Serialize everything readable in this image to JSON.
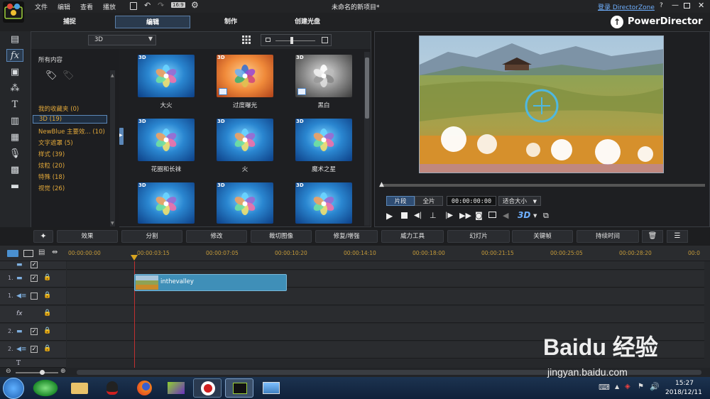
{
  "menu": {
    "file": "文件",
    "edit": "编辑",
    "view": "查看",
    "play": "播放",
    "zoom": "16:9"
  },
  "window_title": "未命名的新项目*",
  "login": "登录 DirectorZone",
  "help": "?",
  "modes": [
    {
      "label": "捕捉"
    },
    {
      "label": "编辑"
    },
    {
      "label": "制作"
    },
    {
      "label": "创建光盘"
    }
  ],
  "brand": "PowerDirector",
  "library": {
    "filter": "3D",
    "all_content": "所有内容",
    "categories": [
      {
        "label": "我的收藏夹  (0)"
      },
      {
        "label": "3D  (19)"
      },
      {
        "label": "NewBlue 主要效...  (10)"
      },
      {
        "label": "文字遮罩  (5)"
      },
      {
        "label": "样式  (39)"
      },
      {
        "label": "炫粒  (20)"
      },
      {
        "label": "特殊  (18)"
      },
      {
        "label": "视觉  (26)"
      }
    ],
    "effects": [
      {
        "label": "大火",
        "badge": "3D",
        "style": "blue"
      },
      {
        "label": "过度曝光",
        "badge": "3D",
        "style": "orange"
      },
      {
        "label": "黑白",
        "badge": "3D",
        "style": "gray"
      },
      {
        "label": "花圈和长袜",
        "badge": "3D",
        "style": "blue"
      },
      {
        "label": "火",
        "badge": "3D",
        "style": "blue"
      },
      {
        "label": "魔术之星",
        "badge": "3D",
        "style": "blue"
      },
      {
        "label": "",
        "badge": "3D",
        "style": "blue"
      },
      {
        "label": "",
        "badge": "3D",
        "style": "blue"
      },
      {
        "label": "",
        "badge": "3D",
        "style": "blue"
      }
    ]
  },
  "preview": {
    "clip_tab": "片段",
    "full_tab": "全片",
    "timecode": "00:00:00:00",
    "fit": "适合大小",
    "threed": "3D"
  },
  "tools": {
    "effects": "效果",
    "split": "分割",
    "modify": "修改",
    "crop": "裁切图像",
    "fix": "修复/增强",
    "power_tools": "威力工具",
    "slideshow": "幻灯片",
    "keyframe": "关键帧",
    "duration": "持续时间"
  },
  "timeline": {
    "ticks": [
      "00:00:00:00",
      "00:00:03:15",
      "00:00:07:05",
      "00:00:10:20",
      "00:00:14:10",
      "00:00:18:00",
      "00:00:21:15",
      "00:00:25:05",
      "00:00:28:20",
      "00:0"
    ],
    "tracks": [
      {
        "num": "",
        "icon": "video"
      },
      {
        "num": "1.",
        "icon": "video"
      },
      {
        "num": "1.",
        "icon": "audio"
      },
      {
        "num": "",
        "icon": "fx"
      },
      {
        "num": "2.",
        "icon": "video"
      },
      {
        "num": "2.",
        "icon": "audio"
      }
    ],
    "clip_name": "inthevalley"
  },
  "taskbar": {
    "time": "15:27",
    "date": "2018/12/11"
  },
  "watermark": {
    "brand": "Baidu 经验",
    "url": "jingyan.baidu.com"
  },
  "colors": {
    "accent": "#5b87b8",
    "category_text": "#e2a83a",
    "clip": "#3f8fb8",
    "timeline_marker": "#d9a520"
  }
}
